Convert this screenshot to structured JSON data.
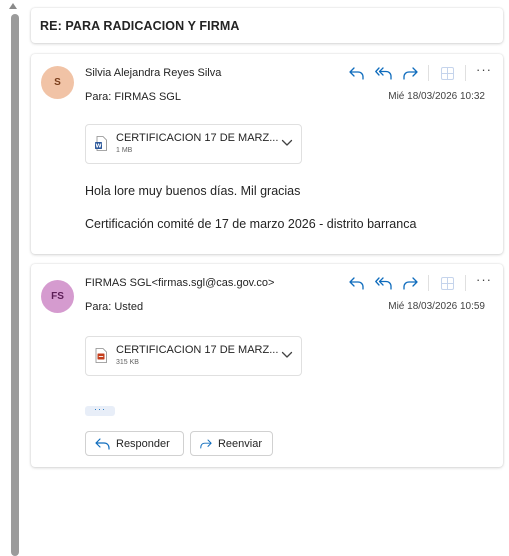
{
  "subject": "RE: PARA RADICACION Y FIRMA",
  "colors": {
    "action_blue": "#0f6cbd",
    "avatar1_bg": "#f1c3a6",
    "avatar1_fg": "#7a3d1a",
    "avatar2_bg": "#d59bcf",
    "avatar2_fg": "#5c1e56",
    "word_blue": "#2b579a",
    "pdf_red": "#c43e1c"
  },
  "messages": [
    {
      "avatar_initials": "S",
      "sender": "Silvia Alejandra Reyes Silva",
      "to": "Para:  FIRMAS SGL",
      "date": "Mié 18/03/2026 10:32",
      "attachment": {
        "icon": "word-file-icon",
        "name": "CERTIFICACION 17 DE MARZ...",
        "size": "1 MB"
      },
      "body": [
        "Hola lore muy buenos días. Mil gracias",
        "Certificación comité de 17 de marzo 2026 - distrito barranca"
      ]
    },
    {
      "avatar_initials": "FS",
      "sender": "FIRMAS SGL<firmas.sgl@cas.gov.co>",
      "to": "Para:  Usted",
      "date": "Mié 18/03/2026 10:59",
      "attachment": {
        "icon": "pdf-file-icon",
        "name": "CERTIFICACION 17 DE MARZ...",
        "size": "315 KB"
      },
      "show_more": "···",
      "reply_label": "Responder",
      "forward_label": "Reenviar"
    }
  ],
  "icons": [
    "reply-icon",
    "reply-all-icon",
    "forward-icon",
    "apps-icon",
    "more-icon",
    "chevron-down-icon"
  ]
}
